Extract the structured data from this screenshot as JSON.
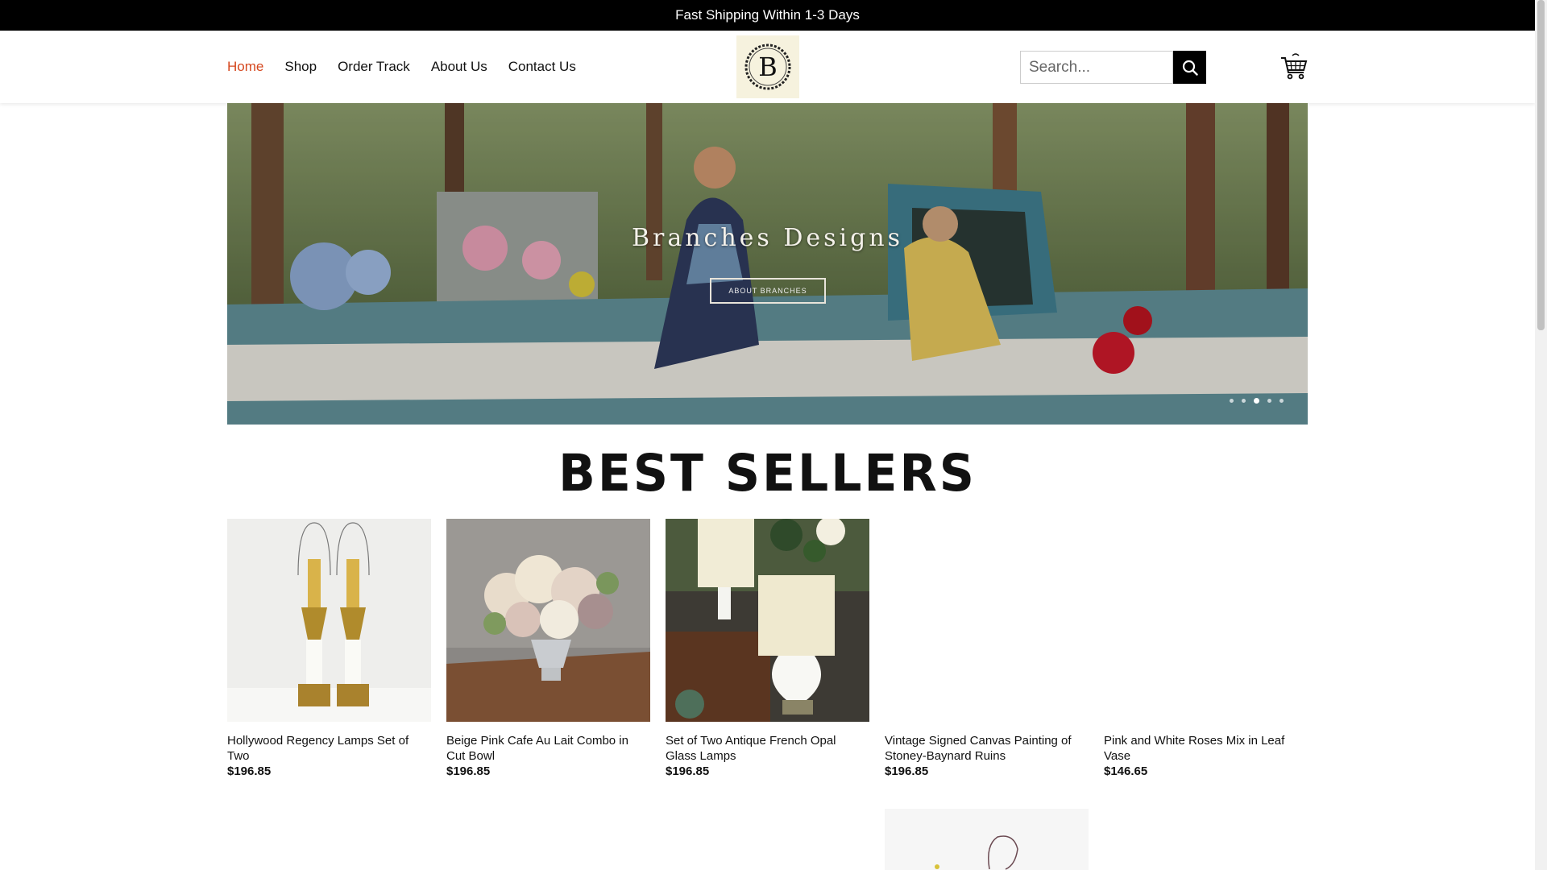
{
  "announcement": "Fast Shipping Within 1-3 Days",
  "nav": {
    "items": [
      "Home",
      "Shop",
      "Order Track",
      "About Us",
      "Contact Us"
    ],
    "active_color": "#d5471e"
  },
  "logo_letter": "B",
  "search": {
    "placeholder": "Search..."
  },
  "hero": {
    "title": "Branches Designs",
    "button": "ABOUT BRANCHES",
    "active_slide": 3,
    "slides": 5
  },
  "best_sellers": {
    "heading": "BEST SELLERS",
    "products": [
      {
        "name": "Hollywood Regency Lamps Set of Two",
        "price": "$196.85"
      },
      {
        "name": "Beige Pink Cafe Au Lait Combo in Cut Bowl",
        "price": "$196.85"
      },
      {
        "name": "Set of Two Antique French Opal Glass Lamps",
        "price": "$196.85"
      },
      {
        "name": "Vintage Signed Canvas Painting of Stoney-Baynard Ruins",
        "price": "$196.85"
      },
      {
        "name": "Pink and White Roses Mix in Leaf Vase",
        "price": "$146.65"
      }
    ]
  },
  "icons": [
    "search-icon",
    "cart-icon"
  ]
}
